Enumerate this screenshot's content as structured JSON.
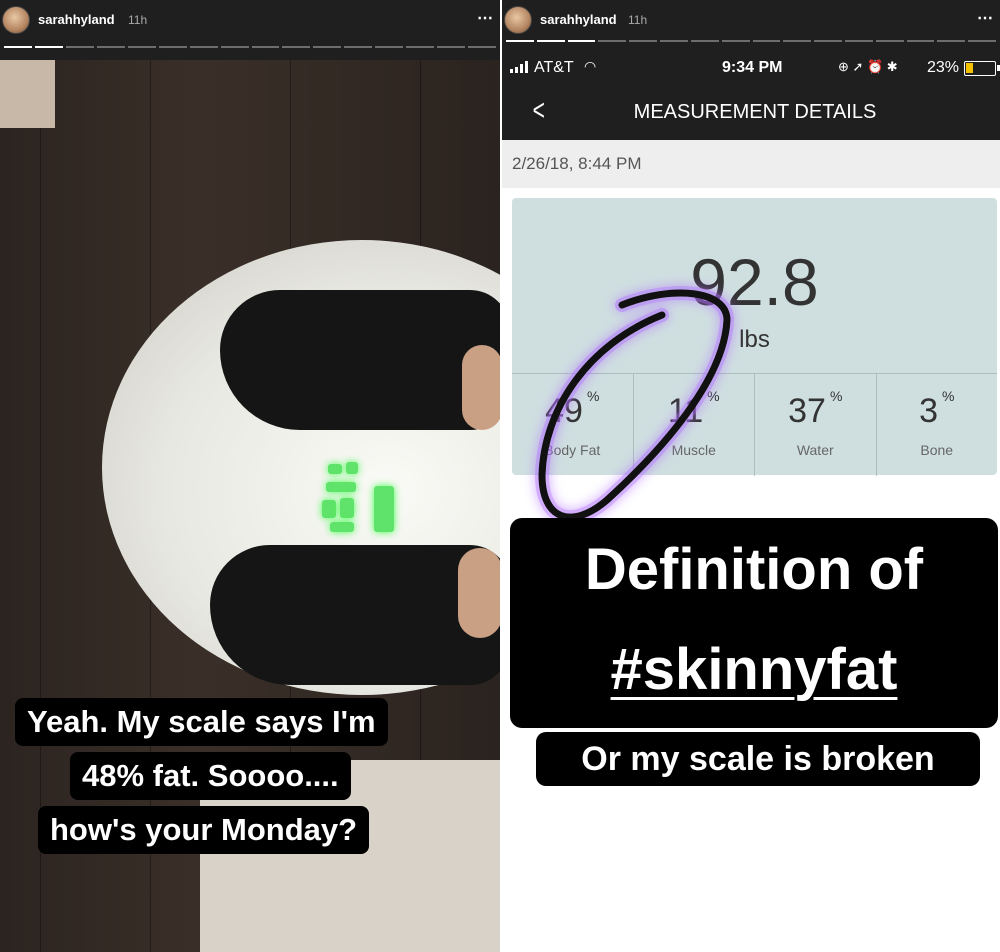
{
  "left_story": {
    "username": "sarahhyland",
    "time": "11h",
    "caption_lines": [
      "Yeah. My scale says I'm",
      "48% fat. Soooo....",
      "how's your Monday?"
    ]
  },
  "right_story": {
    "username": "sarahhyland",
    "time": "11h",
    "status_bar": {
      "carrier": "AT&T",
      "time": "9:34 PM",
      "battery": "23%"
    },
    "nav_title": "MEASUREMENT DETAILS",
    "date": "2/26/18, 8:44 PM",
    "weight": "92.8",
    "weight_unit": "lbs",
    "metrics": [
      {
        "value": "49",
        "unit": "%",
        "label": "Body Fat"
      },
      {
        "value": "11",
        "unit": "%",
        "label": "Muscle"
      },
      {
        "value": "37",
        "unit": "%",
        "label": "Water"
      },
      {
        "value": "3",
        "unit": "%",
        "label": "Bone"
      }
    ],
    "caption_main_line1": "Definition of",
    "caption_main_line2": "#skinnyfat",
    "caption_sub": "Or my scale is broken",
    "colors": {
      "highlight_ring": "#b06cff",
      "status_bg": "#1f1f1f",
      "card_bg": "#cfdfe0"
    }
  }
}
